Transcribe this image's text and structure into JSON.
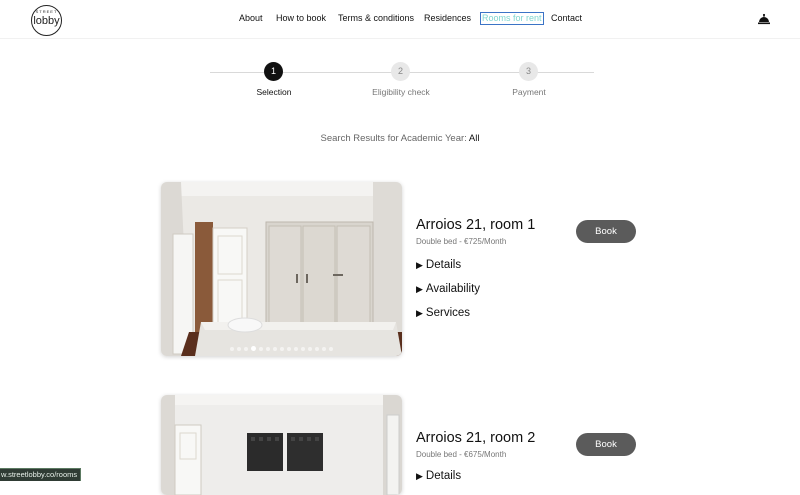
{
  "header": {
    "logo_small": "STREET",
    "logo_main": "lobby",
    "nav": [
      "About",
      "How to book",
      "Terms & conditions",
      "Residences",
      "Rooms for rent",
      "Contact"
    ],
    "active_nav": "Rooms for rent",
    "right_icon": "reception-bell-icon"
  },
  "stepper": {
    "steps": [
      {
        "number": "1",
        "label": "Selection",
        "active": true
      },
      {
        "number": "2",
        "label": "Eligibility check",
        "active": false
      },
      {
        "number": "3",
        "label": "Payment",
        "active": false
      }
    ]
  },
  "search": {
    "label": "Search Results for Academic Year:",
    "value": "All"
  },
  "rooms": [
    {
      "title": "Arroios 21, room 1",
      "subtitle": "Double bed - €725/Month",
      "book_label": "Book",
      "toggles": [
        "Details",
        "Availability",
        "Services"
      ],
      "photo_count": 15,
      "photo_index": 3
    },
    {
      "title": "Arroios 21, room 2",
      "subtitle": "Double bed - €675/Month",
      "book_label": "Book",
      "toggles": [
        "Details"
      ]
    }
  ],
  "status_bar": {
    "url": "w.streetlobby.co/rooms"
  },
  "colors": {
    "accent": "#7fd6cf",
    "focus_outline": "#3b74c6",
    "book_button": "#5b5b5b",
    "active_step": "#111111"
  }
}
